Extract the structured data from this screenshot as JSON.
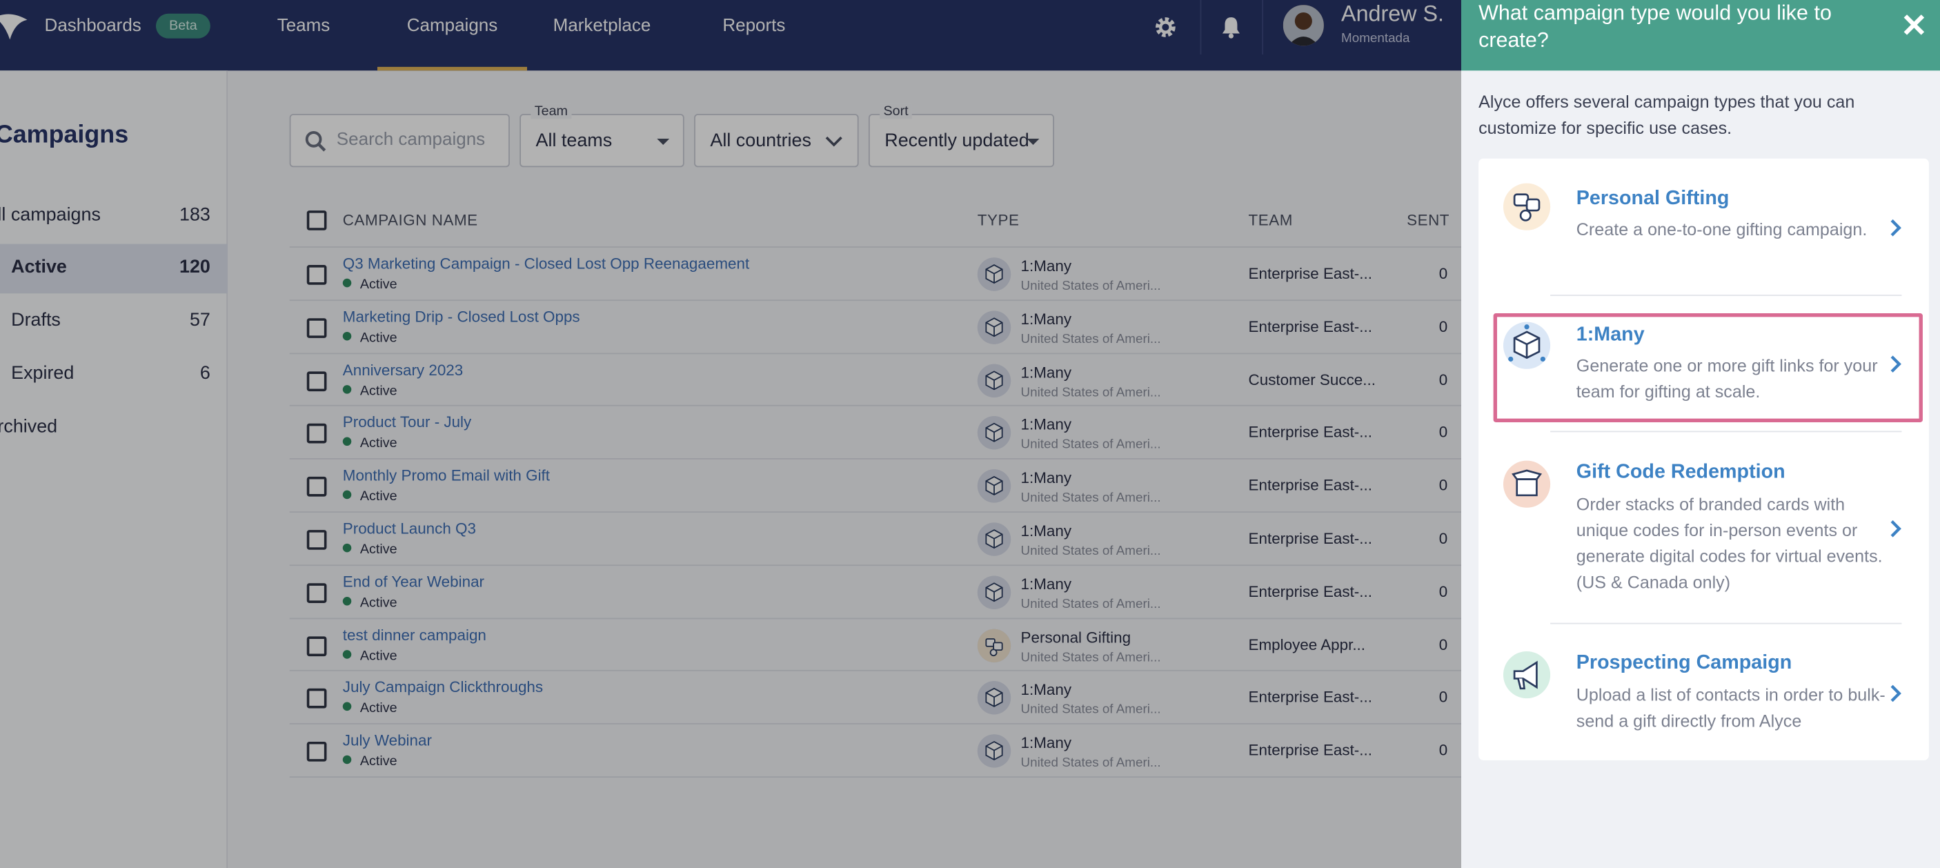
{
  "nav": {
    "dashboards": "Dashboards",
    "beta": "Beta",
    "teams": "Teams",
    "campaigns": "Campaigns",
    "marketplace": "Marketplace",
    "reports": "Reports",
    "user_name": "Andrew S.",
    "user_org": "Momentada"
  },
  "sidebar": {
    "title": "Campaigns",
    "items": [
      {
        "label": "ll campaigns",
        "count": "183"
      },
      {
        "label": "Active",
        "count": "120"
      },
      {
        "label": "Drafts",
        "count": "57"
      },
      {
        "label": "Expired",
        "count": "6"
      },
      {
        "label": "rchived",
        "count": ""
      }
    ]
  },
  "filters": {
    "search_placeholder": "Search campaigns",
    "team_label": "Team",
    "team_value": "All teams",
    "country_value": "All countries",
    "sort_label": "Sort",
    "sort_value": "Recently updated"
  },
  "table": {
    "headers": {
      "name": "CAMPAIGN NAME",
      "type": "TYPE",
      "team": "TEAM",
      "sent": "SENT"
    },
    "rows": [
      {
        "name": "Q3 Marketing Campaign - Closed Lost Opp Reenagaement",
        "status": "Active",
        "type": "1:Many",
        "country": "United States of Ameri...",
        "team": "Enterprise East-...",
        "sent": "0"
      },
      {
        "name": "Marketing Drip - Closed Lost Opps",
        "status": "Active",
        "type": "1:Many",
        "country": "United States of Ameri...",
        "team": "Enterprise East-...",
        "sent": "0"
      },
      {
        "name": "Anniversary 2023",
        "status": "Active",
        "type": "1:Many",
        "country": "United States of Ameri...",
        "team": "Customer Succe...",
        "sent": "0"
      },
      {
        "name": "Product Tour - July",
        "status": "Active",
        "type": "1:Many",
        "country": "United States of Ameri...",
        "team": "Enterprise East-...",
        "sent": "0"
      },
      {
        "name": "Monthly Promo Email with Gift",
        "status": "Active",
        "type": "1:Many",
        "country": "United States of Ameri...",
        "team": "Enterprise East-...",
        "sent": "0"
      },
      {
        "name": "Product Launch Q3",
        "status": "Active",
        "type": "1:Many",
        "country": "United States of Ameri...",
        "team": "Enterprise East-...",
        "sent": "0"
      },
      {
        "name": "End of Year Webinar",
        "status": "Active",
        "type": "1:Many",
        "country": "United States of Ameri...",
        "team": "Enterprise East-...",
        "sent": "0"
      },
      {
        "name": "test dinner campaign",
        "status": "Active",
        "type": "Personal Gifting",
        "country": "United States of Ameri...",
        "team": "Employee Appr...",
        "sent": "0"
      },
      {
        "name": "July Campaign Clickthroughs",
        "status": "Active",
        "type": "1:Many",
        "country": "United States of Ameri...",
        "team": "Enterprise East-...",
        "sent": "0"
      },
      {
        "name": "July Webinar",
        "status": "Active",
        "type": "1:Many",
        "country": "United States of Ameri...",
        "team": "Enterprise East-...",
        "sent": "0"
      }
    ]
  },
  "drawer": {
    "title": "What campaign type would you like to create?",
    "intro": "Alyce offers several campaign types that you can customize for specific use cases.",
    "options": [
      {
        "title": "Personal Gifting",
        "desc": "Create a one-to-one gifting campaign.",
        "icon": "personal-gifting-icon"
      },
      {
        "title": "1:Many",
        "desc": "Generate one or more gift links for your team for gifting at scale.",
        "icon": "one-to-many-box-icon"
      },
      {
        "title": "Gift Code Redemption",
        "desc": "Order stacks of branded cards with unique codes for in-person events or generate digital codes for virtual events. (US & Canada only)",
        "icon": "gift-code-box-icon"
      },
      {
        "title": "Prospecting Campaign",
        "desc": "Upload a list of contacts in order to bulk-send a gift directly from Alyce",
        "icon": "megaphone-icon"
      }
    ]
  },
  "colors": {
    "nav_bg": "#283468",
    "drawer_header": "#4aa08c",
    "link_blue": "#3d82c4",
    "highlight": "#d96a92",
    "active_dot": "#2f8a5f"
  }
}
